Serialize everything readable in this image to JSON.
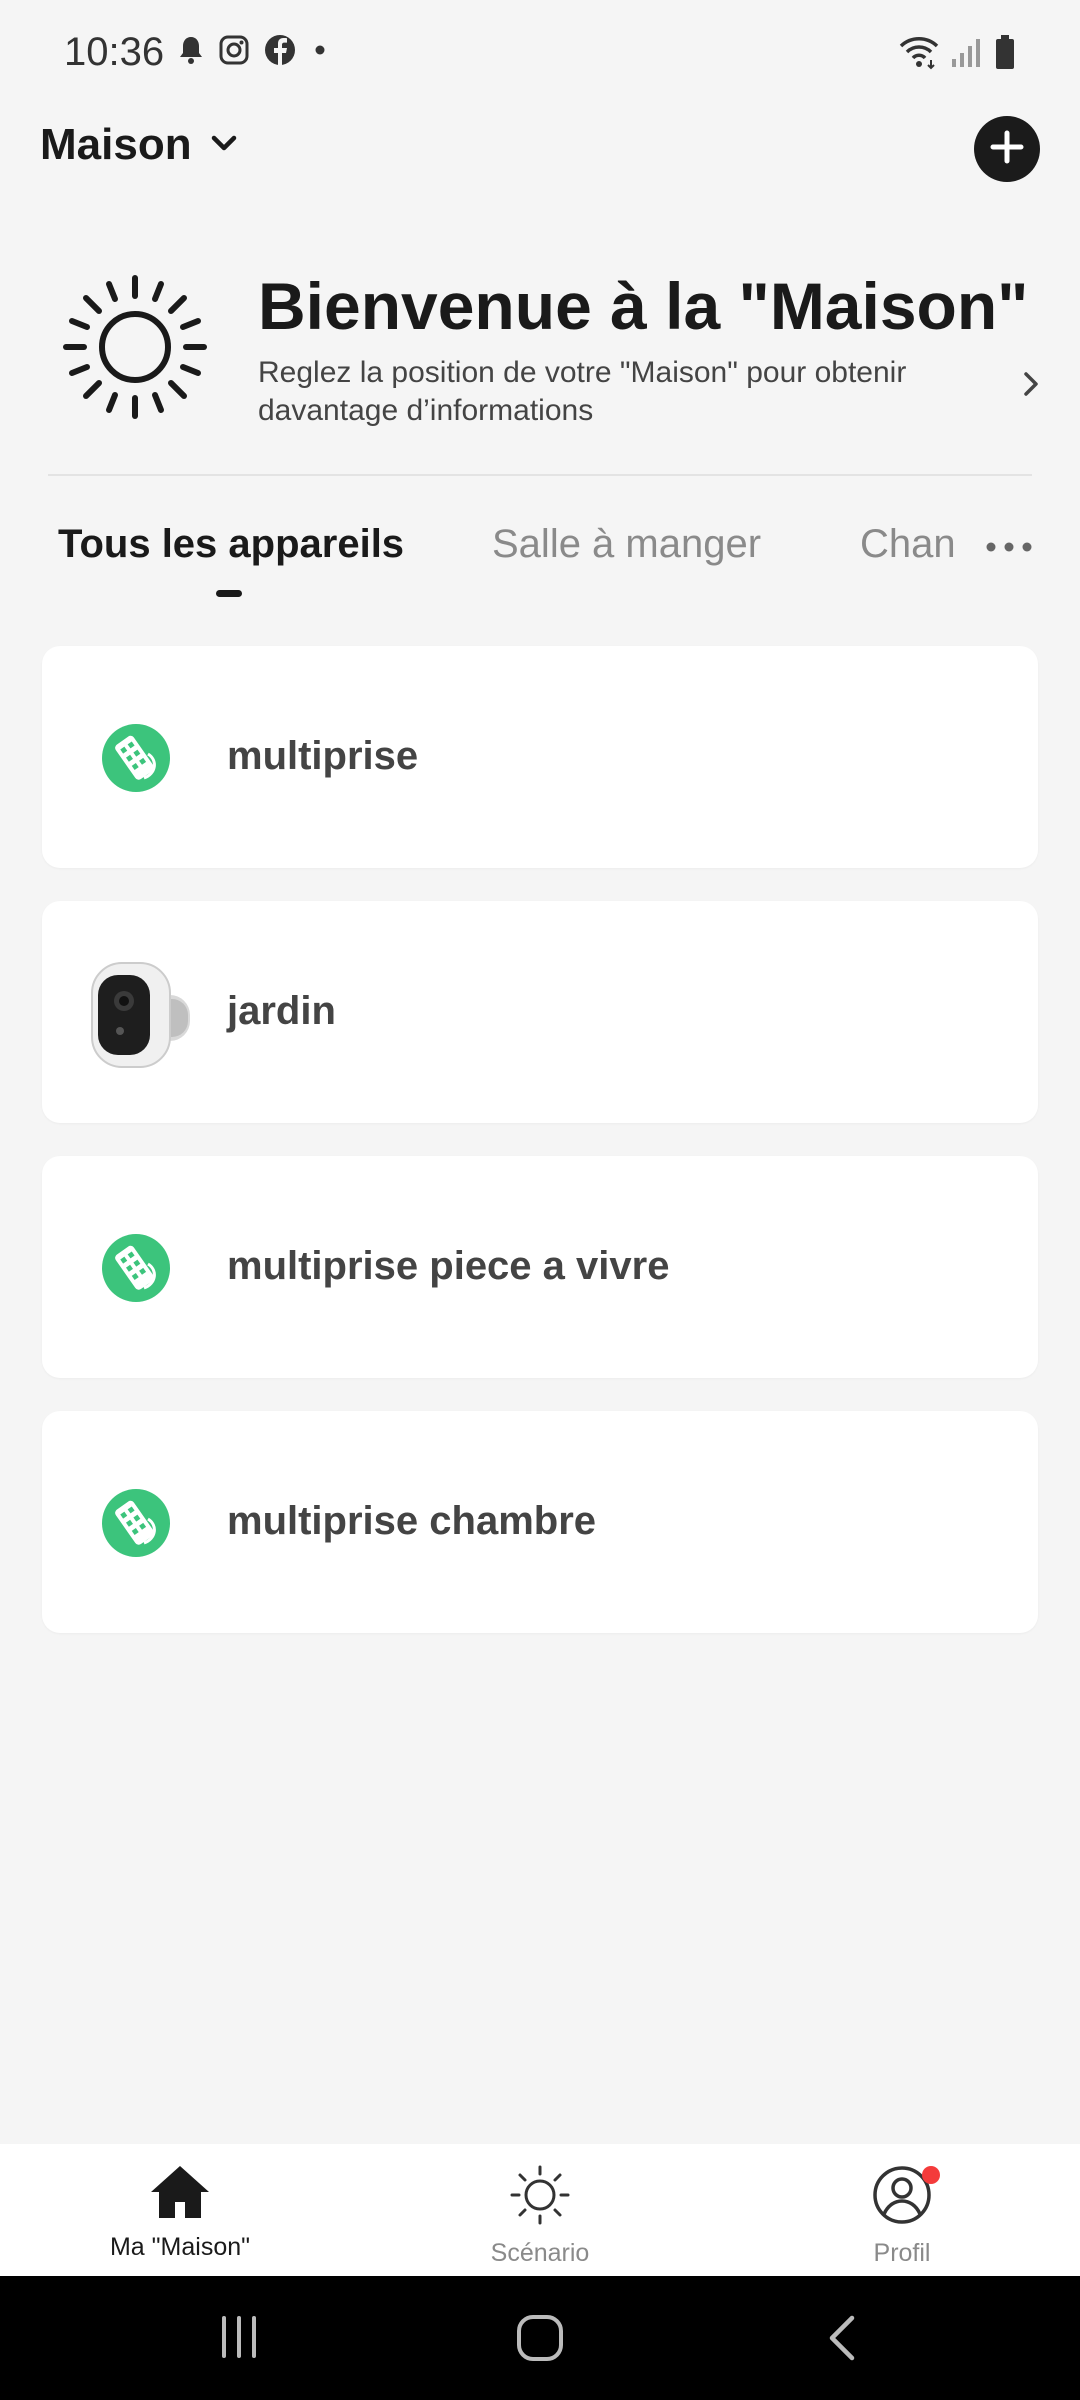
{
  "status_bar": {
    "time": "10:36",
    "left_icons": [
      "bell-icon",
      "instagram-icon",
      "facebook-icon",
      "dot-icon"
    ],
    "right_icons": [
      "wifi-icon",
      "signal-icon",
      "battery-icon"
    ]
  },
  "header": {
    "home_name": "Maison",
    "add_icon": "plus-icon"
  },
  "welcome": {
    "title": "Bienvenue à la \"Maison\"",
    "subtitle": "Reglez la position de votre \"Maison\" pour obtenir davantage d’informations"
  },
  "tabs": [
    {
      "label": "Tous les appareils",
      "active": true
    },
    {
      "label": "Salle à manger",
      "active": false
    },
    {
      "label": "Chan",
      "active": false
    }
  ],
  "devices": [
    {
      "name": "multiprise",
      "icon": "power-strip-icon"
    },
    {
      "name": "jardin",
      "icon": "camera-icon"
    },
    {
      "name": "multiprise piece a vivre",
      "icon": "power-strip-icon"
    },
    {
      "name": "multiprise chambre",
      "icon": "power-strip-icon"
    }
  ],
  "bottom_nav": [
    {
      "label": "Ma \"Maison\"",
      "icon": "home-icon",
      "active": true
    },
    {
      "label": "Scénario",
      "icon": "scene-icon",
      "active": false
    },
    {
      "label": "Profil",
      "icon": "profile-icon",
      "active": false
    }
  ],
  "colors": {
    "background": "#f5f5f5",
    "card": "#ffffff",
    "accent_green": "#3cc47c",
    "badge_red": "#f43b3b",
    "text_dark": "#1a1a1a"
  }
}
